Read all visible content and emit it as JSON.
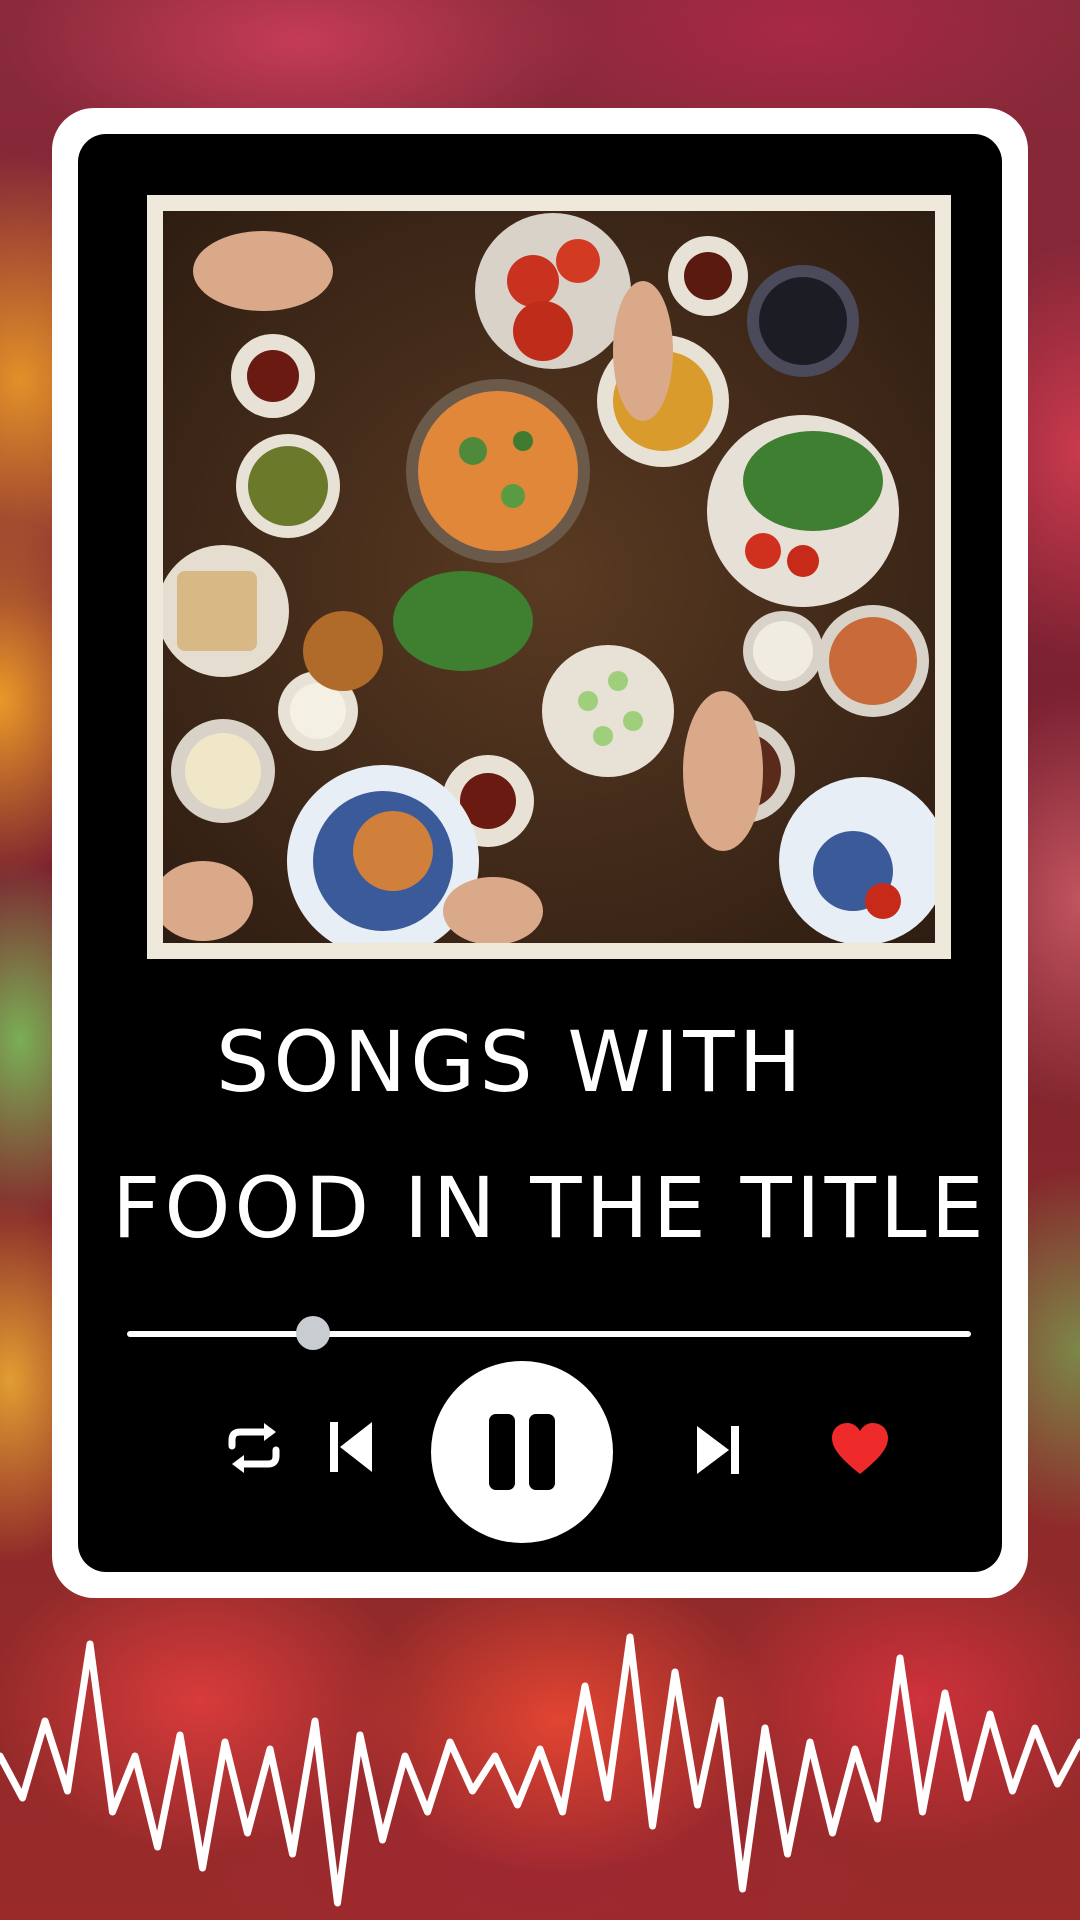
{
  "player": {
    "title_line1": "SONGS WITH",
    "title_line2": "FOOD IN THE TITLE",
    "progress_fraction": 0.22,
    "is_playing": true,
    "liked": true
  },
  "controls": {
    "repeat_icon": "repeat-icon",
    "previous_icon": "skip-previous-icon",
    "play_pause_icon": "pause-icon",
    "next_icon": "skip-next-icon",
    "like_icon": "heart-icon"
  },
  "colors": {
    "card_border": "#ffffff",
    "card_background": "#000000",
    "text": "#ffffff",
    "progress_thumb": "#c9ccd0",
    "heart": "#ee2a2a"
  },
  "album_art": {
    "description_icon": "album-art-image"
  }
}
